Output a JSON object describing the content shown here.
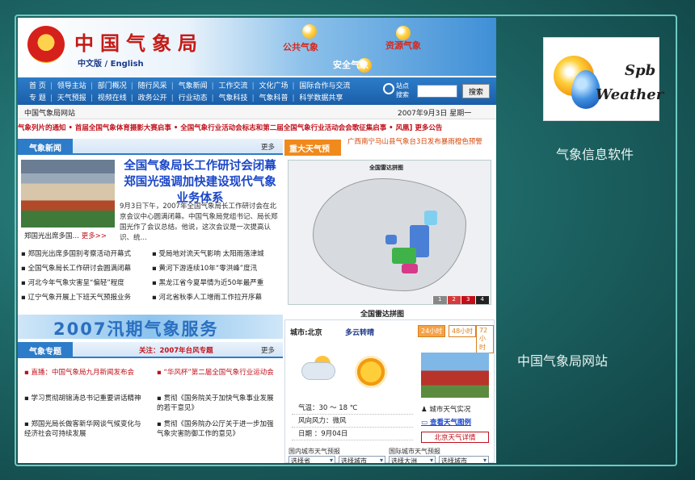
{
  "header": {
    "title": "中国气象局",
    "subtitle": "中文版 / English",
    "slogans": [
      "公共气象",
      "安全气象",
      "资源气象"
    ]
  },
  "nav": {
    "row1": [
      "首  页",
      "领导主站",
      "部门概况",
      "随行风采",
      "气象新闻",
      "工作交流",
      "文化广场",
      "国际合作与交流"
    ],
    "row2": [
      "专  题",
      "天气预报",
      "视频在线",
      "政务公开",
      "行业动态",
      "气象科技",
      "气象科普",
      "科学数据共享"
    ],
    "search_label": "站点搜索",
    "search_button": "搜索"
  },
  "infobar": {
    "site": "中国气象局网站",
    "date": "2007年9月3日  星期一"
  },
  "ticker": "气象列片的通知 • 首届全国气象体育摄影大赛启事 • 全国气象行业活动会标志和第二届全国气象行业活动会会歌征集启事 • 风凰] 更多公告",
  "news": {
    "tab": "气象新闻",
    "more": "更多",
    "headline": "全国气象局长工作研讨会闭幕 郑国光强调加快建设现代气象业务体系",
    "lead": "9月3日下午，2007年全国气象局长工作研讨会在北京会议中心圆满闭幕。中国气象局党组书记、局长郑国光作了会议总结。他说，这次会议是一次提高认识、统…",
    "photo_caption": "郑国光出席多国…",
    "photo_more": "更多>>",
    "items_left": [
      "郑国光出席多国别考察活动开幕式",
      "全国气象局长工作研讨会圆满闭幕",
      "河北今年气象灾害呈“偏轻”程度",
      "辽宁气象开展上下班天气预报业务"
    ],
    "items_right": [
      "受局地对流天气影响 太阳雨落津城",
      "黄河下游连续10年“零洪峰”度汛",
      "黑龙江省今夏旱情为近50年最严重",
      "河北省秋季人工增雨工作拉开序幕"
    ]
  },
  "banner": "2007汛期气象服务",
  "topic": {
    "tab": "气象专题",
    "tip": "关注：2007年台风专题",
    "more": "更多",
    "items_left": [
      "直播：中国气象局九月新闻发布会",
      "学习贯彻胡锦涛总书记重要讲话精神",
      "郑国光局长做客新华网谈气候变化与经济社会可持续发展"
    ],
    "items_right": [
      "“华风杯”第二届全国气象行业运动会",
      "贯彻《国务院关于加快气象事业发展的若干意见》",
      "贯彻《国务院办公厅关于进一步加强气象灾害防御工作的意见》"
    ]
  },
  "warning": {
    "tab": "重大天气预警",
    "text": "广西南宁马山县气象台3日发布暴雨橙色预警"
  },
  "radar": {
    "map_title": "全国雷达拼图",
    "caption": "全国雷达拼图",
    "scale": [
      "1",
      "2",
      "3",
      "4"
    ]
  },
  "forecast": {
    "city": "城市:北京",
    "condition": "多云转晴",
    "tabs": [
      "24小时",
      "48小时",
      "72小时"
    ],
    "temperature": "气温：30 ～ 18 ℃",
    "wind": "风向风力：微风",
    "date": "日期  ：9月04日",
    "live_link": "城市天气实况",
    "map_link": "查看天气图例",
    "detail_button": "北京天气详情",
    "domestic_label": "国内城市天气预报",
    "intl_label": "国际城市天气预报",
    "selects": [
      "选择省",
      "选择城市",
      "选择大洲",
      "选择城市"
    ]
  },
  "right_panel": {
    "logo_line1": "Spb",
    "logo_line2": "Weather",
    "caption1": "气象信息软件",
    "caption2": "中国气象局网站"
  }
}
